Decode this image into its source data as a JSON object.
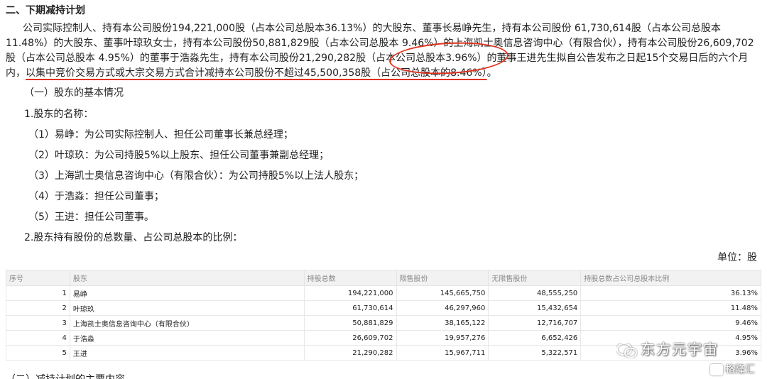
{
  "section": {
    "title": "二、下期减持计划"
  },
  "paragraph": {
    "part1": "公司实际控制人、持有本公司股份194,221,000股（占本公司总股本36.13%）的大股东、董事长易峥先生，持有本公司股份 61,730,614股（占本公司总股本11.48%）的大股东、董事叶琼玖女士，持有本公司股份50,881,829股（占本公司总股本 9.46%）的上海凯士奥信息咨询中心（有限合伙），持有本公司股份26,609,702股（占本公司总股本 4.95%）的董事于浩淼先生，持有本公司股份21,290,282股（占本公司总股本3.96%）的董事王进先生拟自公告发布之日起",
    "part2": "15个交易日后的六个月内",
    "part3": "，",
    "part4": "以集中竞价交易方式或大宗交易方式合计减持本公司股份不超过45,500,358股（占公司总股本的8.46%）",
    "part5": "。"
  },
  "subsection": {
    "basic_info": "（一）股东的基本情况",
    "names_heading": "1.股东的名称：",
    "items": [
      "（1）易峥：为公司实际控制人、担任公司董事长兼总经理；",
      "（2）叶琼玖：为公司持股5%以上股东、担任公司董事兼副总经理；",
      "（3）上海凯士奥信息咨询中心（有限合伙）：为公司持股5%以上法人股东；",
      "（4）于浩淼：担任公司董事；",
      "（5）王进：担任公司董事。"
    ],
    "ratio_heading": "2.股东持有股份的总数量、占公司总股本的比例："
  },
  "unit_label": "单位：股",
  "table": {
    "headers": [
      "序号",
      "股东",
      "持股总数",
      "限售股份",
      "无限售股份",
      "持股总数占公司总股本比例"
    ],
    "rows": [
      [
        "1",
        "易峥",
        "194,221,000",
        "145,665,750",
        "48,555,250",
        "36.13%"
      ],
      [
        "2",
        "叶琼玖",
        "61,730,614",
        "46,297,960",
        "15,432,654",
        "11.48%"
      ],
      [
        "3",
        "上海凯士奥信息咨询中心（有限合伙）",
        "50,881,829",
        "38,165,122",
        "12,716,707",
        "9.46%"
      ],
      [
        "4",
        "于浩淼",
        "26,609,702",
        "19,957,276",
        "6,652,426",
        "4.95%"
      ],
      [
        "5",
        "王进",
        "21,290,282",
        "15,967,711",
        "5,322,571",
        "3.96%"
      ]
    ]
  },
  "cut_line": "（二）减持计划的主要内容",
  "watermarks": {
    "wechat": "东方元宇宙",
    "gelonghui": "格隆汇"
  },
  "colors": {
    "annotation_red": "#e0321e",
    "header_bg": "#f2f2f2"
  }
}
